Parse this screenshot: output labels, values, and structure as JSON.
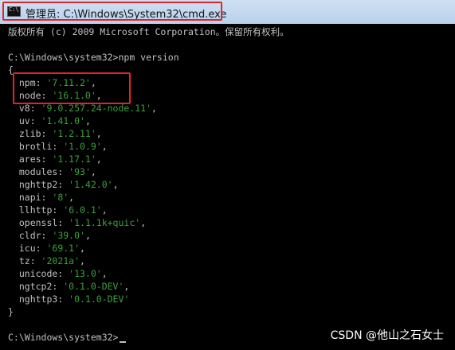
{
  "window": {
    "title": "管理员: C:\\Windows\\System32\\cmd.exe",
    "icon": "console-icon"
  },
  "console": {
    "copyright": "版权所有 (c) 2009 Microsoft Corporation。保留所有权利。",
    "command_prompt": "C:\\Windows\\system32>npm version",
    "open_brace": "{",
    "entries": [
      {
        "key": "npm",
        "value": "'7.11.2'"
      },
      {
        "key": "node",
        "value": "'16.1.0'"
      },
      {
        "key": "v8",
        "value": "'9.0.257.24-node.11'"
      },
      {
        "key": "uv",
        "value": "'1.41.0'"
      },
      {
        "key": "zlib",
        "value": "'1.2.11'"
      },
      {
        "key": "brotli",
        "value": "'1.0.9'"
      },
      {
        "key": "ares",
        "value": "'1.17.1'"
      },
      {
        "key": "modules",
        "value": "'93'"
      },
      {
        "key": "nghttp2",
        "value": "'1.42.0'"
      },
      {
        "key": "napi",
        "value": "'8'"
      },
      {
        "key": "llhttp",
        "value": "'6.0.1'"
      },
      {
        "key": "openssl",
        "value": "'1.1.1k+quic'"
      },
      {
        "key": "cldr",
        "value": "'39.0'"
      },
      {
        "key": "icu",
        "value": "'69.1'"
      },
      {
        "key": "tz",
        "value": "'2021a'"
      },
      {
        "key": "unicode",
        "value": "'13.0'"
      },
      {
        "key": "ngtcp2",
        "value": "'0.1.0-DEV'"
      },
      {
        "key": "nghttp3",
        "value": "'0.1.0-DEV'"
      }
    ],
    "close_brace": "}",
    "final_prompt": "C:\\Windows\\system32>"
  },
  "watermark": "CSDN @他山之石女士",
  "colors": {
    "string": "#3aa23a",
    "text": "#c0c0c0",
    "background": "#000000",
    "highlight": "#e0242a"
  }
}
